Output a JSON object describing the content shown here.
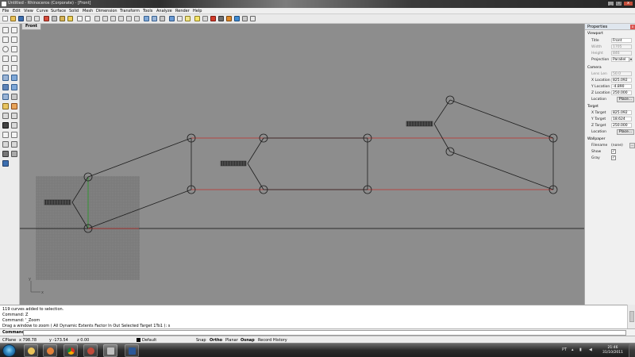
{
  "window": {
    "title": "Untitled - Rhinoceros",
    "subtitle": "(Corporate) - [Front]",
    "buttons": [
      "_",
      "□",
      "x"
    ]
  },
  "menu": [
    "File",
    "Edit",
    "View",
    "Curve",
    "Surface",
    "Solid",
    "Mesh",
    "Dimension",
    "Transform",
    "Tools",
    "Analyze",
    "Render",
    "Help"
  ],
  "viewport": {
    "tab": "Front",
    "axis_y": "y",
    "axis_x": "x"
  },
  "properties": {
    "title": "Properties",
    "close": "x",
    "viewport_section": "Viewport",
    "title_label": "Title",
    "title_value": "Front",
    "width_label": "Width",
    "width_value": "1705",
    "height_label": "Height",
    "height_value": "846",
    "projection_label": "Projection",
    "projection_value": "Parallel",
    "camera_section": "Camera",
    "lens_label": "Lens Len",
    "lens_value": "50.0",
    "xloc_label": "X Location",
    "xloc_value": "825.092",
    "yloc_label": "Y Location",
    "yloc_value": "-4.890",
    "zloc_label": "Z Location",
    "zloc_value": "250.000",
    "location_label": "Location",
    "place_button": "Place...",
    "target_section": "Target",
    "xt_label": "X Target",
    "xt_value": "825.092",
    "yt_label": "Y Target",
    "yt_value": "18.624",
    "zt_label": "Z Target",
    "zt_value": "250.000",
    "tlocation_label": "Location",
    "tplace_button": "Place...",
    "wallpaper_section": "Wallpaper",
    "filename_label": "Filename",
    "filename_value": "(none)",
    "filename_button": "...",
    "show_label": "Show",
    "show_check": "✓",
    "gray_label": "Gray",
    "gray_check": "✓"
  },
  "history": [
    "119 curves added to selection.",
    "Command: Z",
    "Command: '_Zoom",
    "Drag a window to zoom ( All  Dynamic  Extents  Factor  In  Out  Selected  Target  1To1 ): s"
  ],
  "command": {
    "label": "Command:"
  },
  "status": {
    "cplane": "CPlane",
    "x": "x 798.78",
    "y": "y -173.54",
    "z": "z 0.00",
    "layer": "Default",
    "snap": "Snap",
    "ortho": "Ortho",
    "planar": "Planar",
    "osnap": "Osnap",
    "record": "Record History"
  },
  "taskbar": {
    "lang": "PT",
    "time": "21:46",
    "date": "31/10/2011"
  },
  "colors": {
    "viewport_bg": "#8d8d8d",
    "curve": "#1e1e1e",
    "selected_red": "#c0302c",
    "green_line": "#1f9a1f"
  }
}
